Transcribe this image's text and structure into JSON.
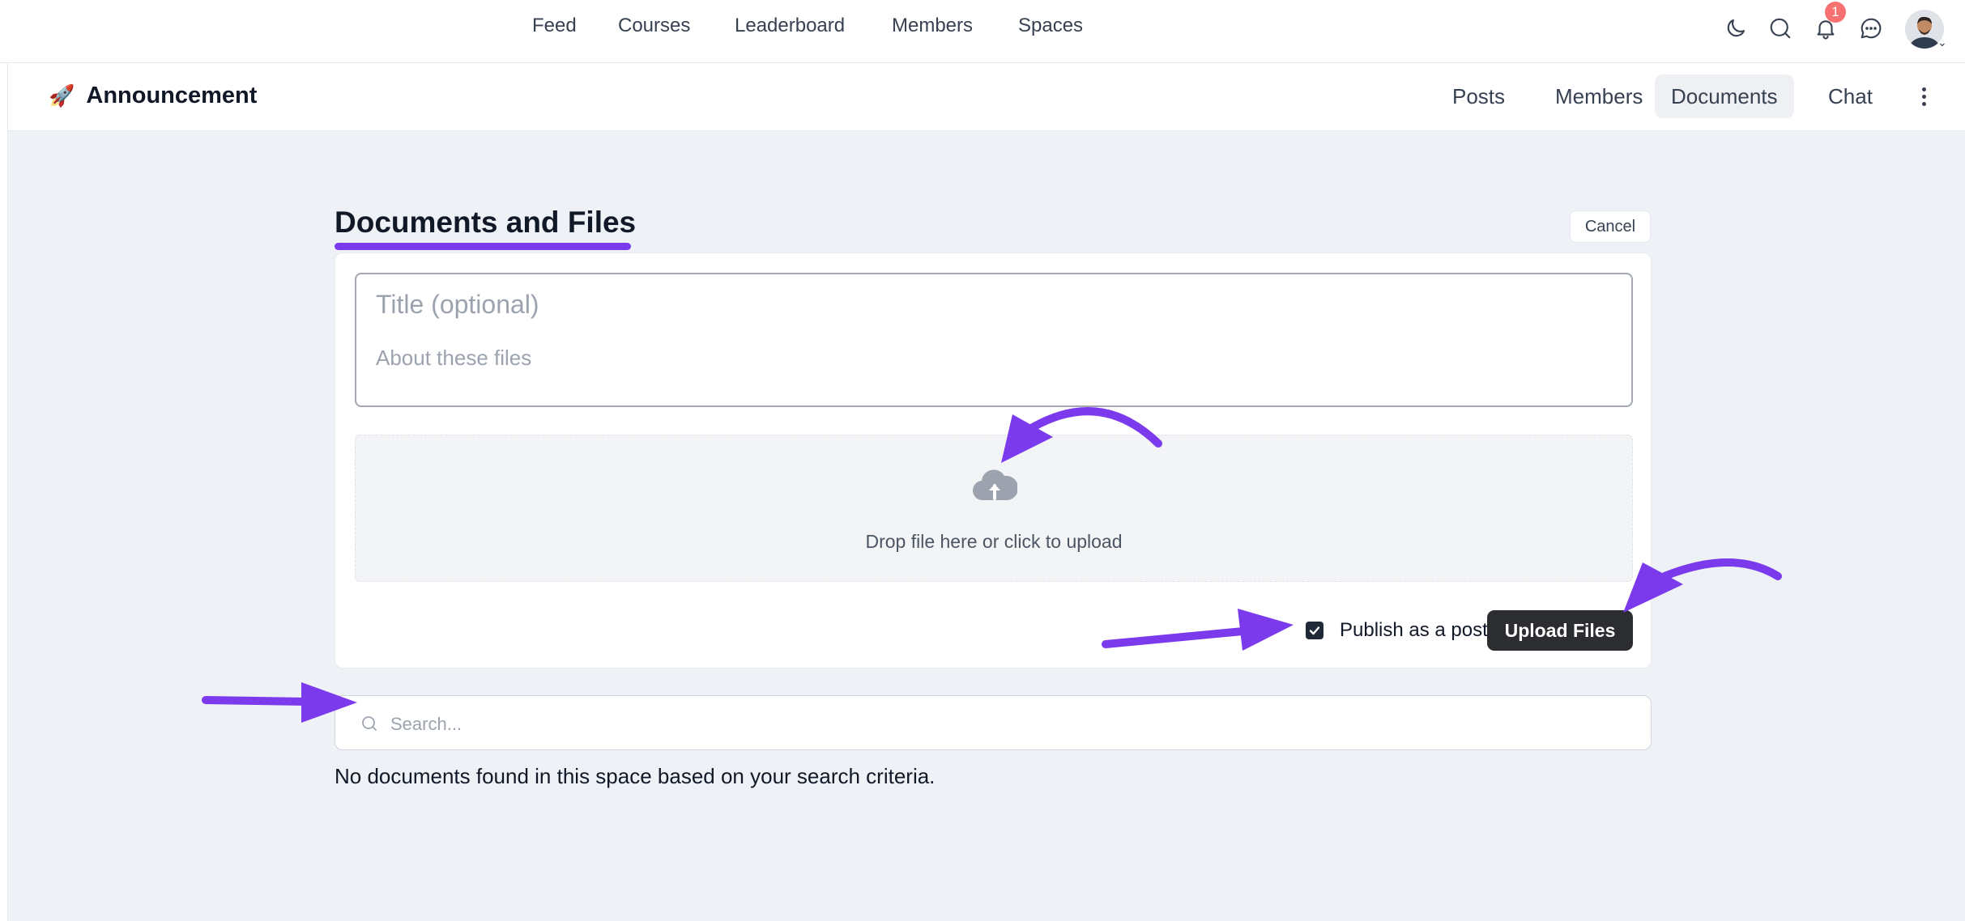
{
  "top_nav": {
    "links": [
      "Feed",
      "Courses",
      "Leaderboard",
      "Members",
      "Spaces"
    ],
    "notification_count": "1"
  },
  "space": {
    "emoji": "🚀",
    "title": "Announcement",
    "tabs": [
      "Posts",
      "Members",
      "Documents",
      "Chat"
    ],
    "active_tab": "Documents"
  },
  "documents": {
    "heading": "Documents and Files",
    "cancel_label": "Cancel",
    "title_placeholder": "Title (optional)",
    "about_placeholder": "About these files",
    "dropzone_text": "Drop file here or click to upload",
    "publish_label": "Publish as a post",
    "publish_checked": true,
    "upload_label": "Upload Files",
    "search_placeholder": "Search...",
    "empty_message": "No documents found in this space based on your search criteria."
  },
  "colors": {
    "accent_annotation": "#7c3aed",
    "upload_button": "#2b2d31",
    "badge": "#f87171",
    "page_background": "#eef1f5"
  },
  "icons": {
    "theme_toggle": "moon-icon",
    "search": "search-icon",
    "notifications": "bell-icon",
    "messages": "chat-bubble-icon",
    "upload": "cloud-upload-icon",
    "more": "kebab-menu-icon"
  }
}
